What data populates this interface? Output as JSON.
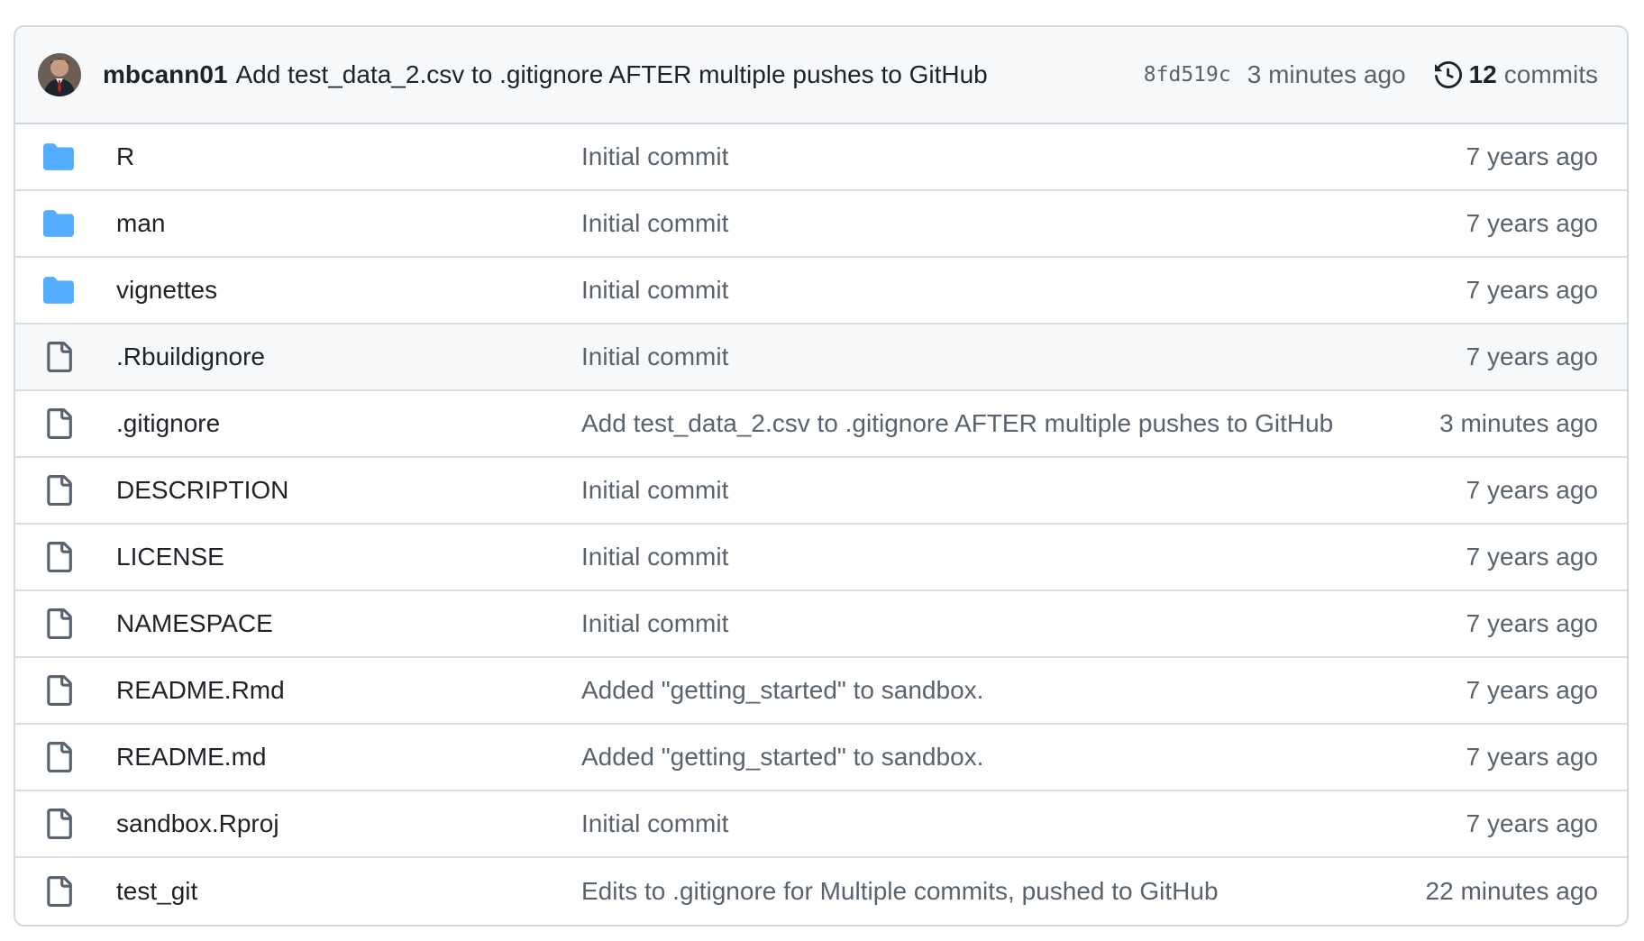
{
  "latest_commit": {
    "author": "mbcann01",
    "message": "Add test_data_2.csv to .gitignore AFTER multiple pushes to GitHub",
    "sha": "8fd519c",
    "time": "3 minutes ago",
    "commit_count": "12",
    "commits_label": "commits"
  },
  "files": [
    {
      "type": "folder",
      "name": "R",
      "message": "Initial commit",
      "age": "7 years ago"
    },
    {
      "type": "folder",
      "name": "man",
      "message": "Initial commit",
      "age": "7 years ago"
    },
    {
      "type": "folder",
      "name": "vignettes",
      "message": "Initial commit",
      "age": "7 years ago"
    },
    {
      "type": "file",
      "name": ".Rbuildignore",
      "message": "Initial commit",
      "age": "7 years ago"
    },
    {
      "type": "file",
      "name": ".gitignore",
      "message": "Add test_data_2.csv to .gitignore AFTER multiple pushes to GitHub",
      "age": "3 minutes ago"
    },
    {
      "type": "file",
      "name": "DESCRIPTION",
      "message": "Initial commit",
      "age": "7 years ago"
    },
    {
      "type": "file",
      "name": "LICENSE",
      "message": "Initial commit",
      "age": "7 years ago"
    },
    {
      "type": "file",
      "name": "NAMESPACE",
      "message": "Initial commit",
      "age": "7 years ago"
    },
    {
      "type": "file",
      "name": "README.Rmd",
      "message": "Added \"getting_started\" to sandbox.",
      "age": "7 years ago"
    },
    {
      "type": "file",
      "name": "README.md",
      "message": "Added \"getting_started\" to sandbox.",
      "age": "7 years ago"
    },
    {
      "type": "file",
      "name": "sandbox.Rproj",
      "message": "Initial commit",
      "age": "7 years ago"
    },
    {
      "type": "file",
      "name": "test_git",
      "message": "Edits to .gitignore for Multiple commits, pushed to GitHub",
      "age": "22 minutes ago"
    }
  ],
  "colors": {
    "folder_icon": "#54aeff",
    "file_icon": "#59636e",
    "muted_text": "#59636e",
    "header_bg": "#f6f8fa",
    "border": "#d0d7de"
  },
  "icons": {
    "folder": "folder-icon",
    "file": "file-icon",
    "history": "history-icon"
  }
}
